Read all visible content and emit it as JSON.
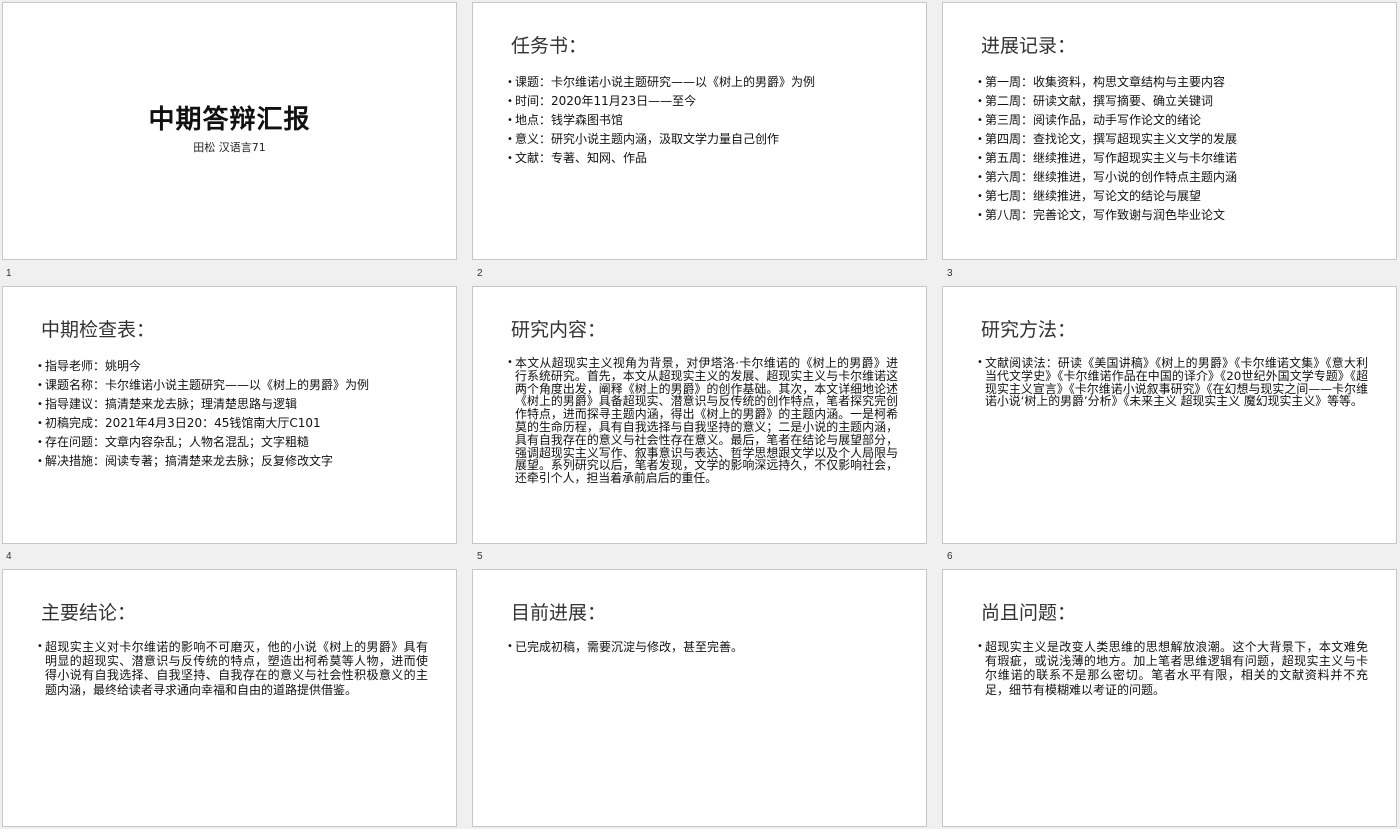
{
  "slides": [
    {
      "number": "1",
      "title": "中期答辩汇报",
      "subtitle": "田松 汉语言71"
    },
    {
      "number": "2",
      "title": "任务书：",
      "bullets": [
        "课题：卡尔维诺小说主题研究——以《树上的男爵》为例",
        "时间：2020年11月23日——至今",
        "地点：钱学森图书馆",
        "意义：研究小说主题内涵，汲取文学力量自己创作",
        "文献：专著、知网、作品"
      ]
    },
    {
      "number": "3",
      "title": "进展记录：",
      "bullets": [
        "第一周：收集资料，构思文章结构与主要内容",
        "第二周：研读文献，撰写摘要、确立关键词",
        "第三周：阅读作品，动手写作论文的绪论",
        "第四周：查找论文，撰写超现实主义文学的发展",
        "第五周：继续推进，写作超现实主义与卡尔维诺",
        "第六周：继续推进，写小说的创作特点主题内涵",
        "第七周：继续推进，写论文的结论与展望",
        "第八周：完善论文，写作致谢与润色毕业论文"
      ]
    },
    {
      "number": "4",
      "title": "中期检查表：",
      "bullets": [
        "指导老师：姚明今",
        "课题名称：卡尔维诺小说主题研究——以《树上的男爵》为例",
        "指导建议：搞清楚来龙去脉；理清楚思路与逻辑",
        "初稿完成：2021年4月3日20：45钱馆南大厅C101",
        "存在问题：文章内容杂乱；人物名混乱；文字粗糙",
        "解决措施：阅读专著；搞清楚来龙去脉；反复修改文字"
      ]
    },
    {
      "number": "5",
      "title": "研究内容：",
      "paragraph": "本文从超现实主义视角为背景，对伊塔洛·卡尔维诺的《树上的男爵》进行系统研究。首先，本文从超现实主义的发展、超现实主义与卡尔维诺这两个角度出发，阐释《树上的男爵》的创作基础。其次，本文详细地论述《树上的男爵》具备超现实、潜意识与反传统的创作特点，笔者探究完创作特点，进而探寻主题内涵，得出《树上的男爵》的主题内涵。一是柯希莫的生命历程，具有自我选择与自我坚持的意义；二是小说的主题内涵，具有自我存在的意义与社会性存在意义。最后，笔者在结论与展望部分，强调超现实主义写作、叙事意识与表达、哲学思想跟文学以及个人局限与展望。系列研究以后，笔者发现，文学的影响深远持久，不仅影响社会，还牵引个人，担当着承前启后的重任。"
    },
    {
      "number": "6",
      "title": "研究方法：",
      "paragraph": "文献阅读法：研读《美国讲稿》《树上的男爵》《卡尔维诺文集》《意大利当代文学史》《卡尔维诺作品在中国的译介》《20世纪外国文学专题》《超现实主义宣言》《卡尔维诺小说叙事研究》《在幻想与现实之间——卡尔维诺小说‘树上的男爵’分析》《未来主义 超现实主义 魔幻现实主义》等等。"
    },
    {
      "number": "",
      "title": "主要结论：",
      "paragraph": "超现实主义对卡尔维诺的影响不可磨灭，他的小说《树上的男爵》具有明显的超现实、潜意识与反传统的特点，塑造出柯希莫等人物，进而使得小说有自我选择、自我坚持、自我存在的意义与社会性积极意义的主题内涵，最终给读者寻求通向幸福和自由的道路提供借鉴。"
    },
    {
      "number": "",
      "title": "目前进展：",
      "paragraph": "已完成初稿，需要沉淀与修改，甚至完善。"
    },
    {
      "number": "",
      "title": "尚且问题：",
      "paragraph": "超现实主义是改变人类思维的思想解放浪潮。这个大背景下，本文难免有瑕疵，或说浅薄的地方。加上笔者思维逻辑有问题，超现实主义与卡尔维诺的联系不是那么密切。笔者水平有限，相关的文献资料并不充足，细节有模糊难以考证的问题。"
    }
  ]
}
